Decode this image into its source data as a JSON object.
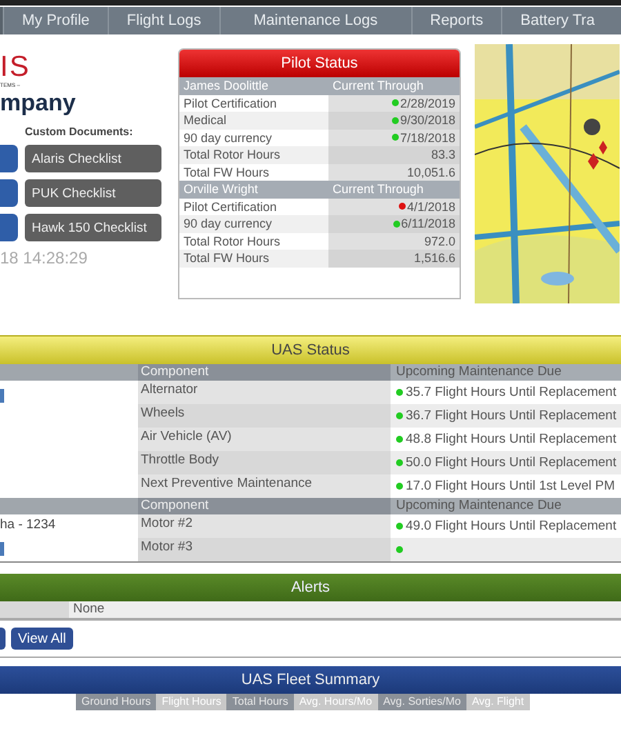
{
  "nav": {
    "items": [
      {
        "label": "My Profile"
      },
      {
        "label": "Flight Logs"
      },
      {
        "label": "Maintenance Logs"
      },
      {
        "label": "Reports"
      },
      {
        "label": "Battery Tra"
      }
    ]
  },
  "logo": {
    "mark": "IS",
    "tagline": "TEMS –",
    "company": "mpany"
  },
  "documents": {
    "title": "Custom Documents:",
    "buttons": [
      "Alaris Checklist",
      "PUK Checklist",
      "Hawk 150 Checklist"
    ]
  },
  "timestamp": "18 14:28:29",
  "pilot_status": {
    "title": "Pilot Status",
    "pilots": [
      {
        "name": "James Doolittle",
        "column": "Current Through",
        "rows": [
          {
            "label": "Pilot Certification",
            "value": "2/28/2019",
            "color": "#22cc22"
          },
          {
            "label": "Medical",
            "value": "9/30/2018",
            "color": "#22cc22"
          },
          {
            "label": "90 day currency",
            "value": "7/18/2018",
            "color": "#22cc22"
          },
          {
            "label": "Total Rotor Hours",
            "value": "83.3"
          },
          {
            "label": "Total FW Hours",
            "value": "10,051.6"
          }
        ]
      },
      {
        "name": "Orville Wright",
        "column": "Current Through",
        "rows": [
          {
            "label": "Pilot Certification",
            "value": "4/1/2018",
            "color": "#dd1111"
          },
          {
            "label": "90 day currency",
            "value": "6/11/2018",
            "color": "#22cc22"
          },
          {
            "label": "Total Rotor Hours",
            "value": "972.0"
          },
          {
            "label": "Total FW Hours",
            "value": "1,516.6"
          }
        ]
      }
    ]
  },
  "uas_status": {
    "title": "UAS Status",
    "groups": [
      {
        "columns": [
          "Component",
          "Upcoming Maintenance Due"
        ],
        "rows": [
          {
            "component": "Alternator",
            "due": "35.7 Flight Hours Until Replacement",
            "color": "#22cc22"
          },
          {
            "component": "Wheels",
            "due": "36.7 Flight Hours Until Replacement",
            "color": "#22cc22"
          },
          {
            "component": "Air Vehicle (AV)",
            "due": "48.8 Flight Hours Until Replacement",
            "color": "#22cc22"
          },
          {
            "component": "Throttle Body",
            "due": "50.0 Flight Hours Until Replacement",
            "color": "#22cc22"
          },
          {
            "component": "Next Preventive Maintenance",
            "due": "17.0 Flight Hours Until 1st Level PM",
            "color": "#22cc22"
          }
        ]
      },
      {
        "vehicle": "ha - 1234",
        "columns": [
          "Component",
          "Upcoming Maintenance Due"
        ],
        "rows": [
          {
            "component": "Motor #2",
            "due": "49.0 Flight Hours Until Replacement",
            "color": "#22cc22"
          },
          {
            "component": "Motor #3",
            "color": "#22cc22"
          }
        ]
      }
    ]
  },
  "alerts": {
    "title": "Alerts",
    "rows": [
      {
        "text": "None"
      }
    ],
    "buttons": [
      "View All"
    ]
  },
  "fleet_summary": {
    "title": "UAS Fleet Summary",
    "columns": [
      "Ground Hours",
      "Flight Hours",
      "Total Hours",
      "Avg. Hours/Mo",
      "Avg. Sorties/Mo",
      "Avg. Flight"
    ]
  }
}
